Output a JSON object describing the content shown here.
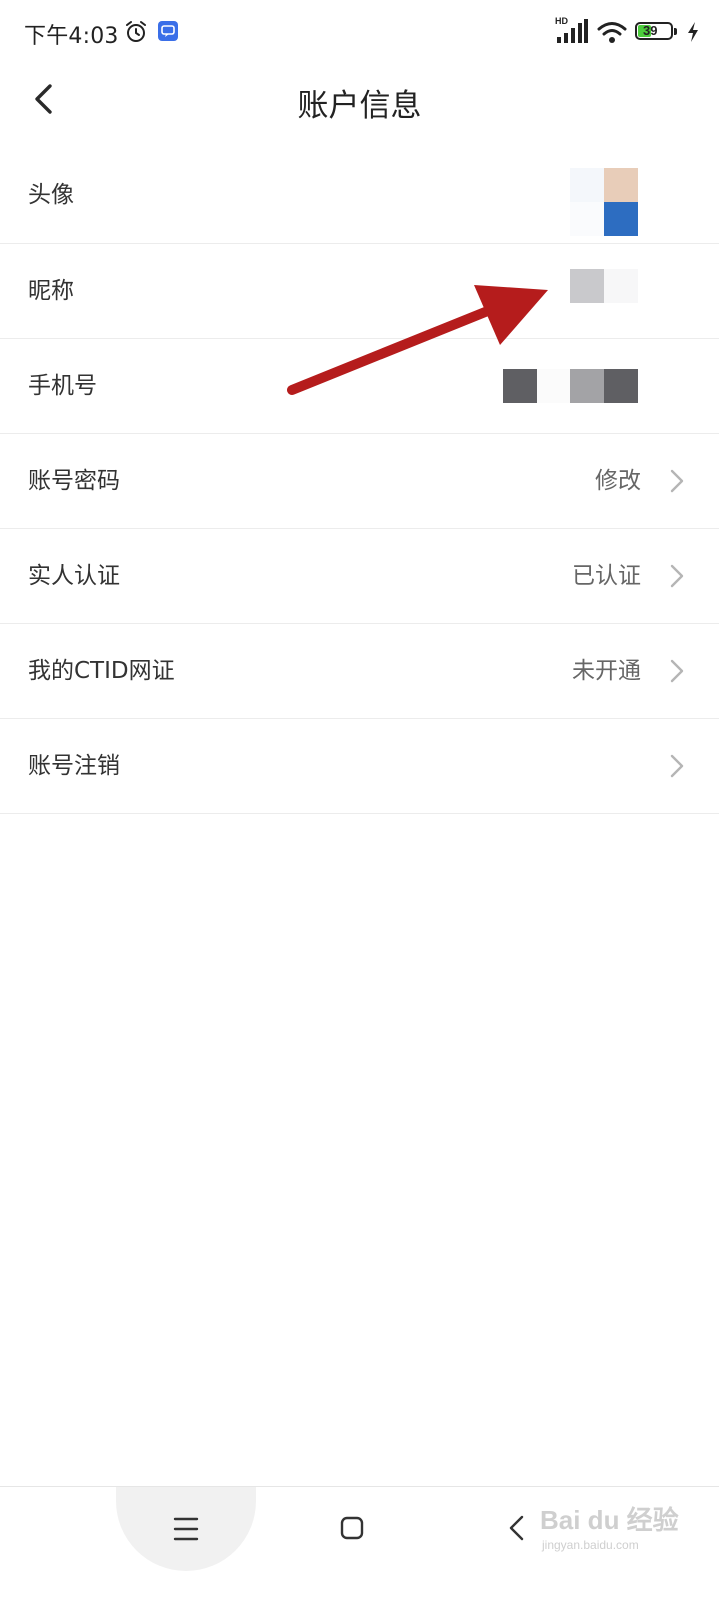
{
  "status_bar": {
    "time": "下午4:03",
    "network_label": "HD",
    "battery_level": "39",
    "charging": true,
    "alarm_icon": "alarm-clock-icon",
    "app_notification_icon": "chat-notification-icon"
  },
  "header": {
    "title": "账户信息",
    "back_icon": "back-chevron-icon"
  },
  "rows": [
    {
      "label": "头像",
      "value": "",
      "has_chevron": false
    },
    {
      "label": "昵称",
      "value": "",
      "has_chevron": false
    },
    {
      "label": "手机号",
      "value": "",
      "has_chevron": false
    },
    {
      "label": "账号密码",
      "value": "修改",
      "has_chevron": true
    },
    {
      "label": "实人认证",
      "value": "已认证",
      "has_chevron": true
    },
    {
      "label": "我的CTID网证",
      "value": "未开通",
      "has_chevron": true
    },
    {
      "label": "账号注销",
      "value": "",
      "has_chevron": true
    }
  ],
  "annotation": {
    "color": "#b51c1c",
    "icon": "red-arrow-annotation"
  },
  "navigation_bar": {
    "menu_icon": "menu-icon",
    "home_icon": "home-square-icon",
    "back_icon": "back-chevron-icon"
  },
  "watermark": {
    "main": "Bai du 经验",
    "sub": "jingyan.baidu.com"
  },
  "colors": {
    "accent_app_icon": "#3b6fe8",
    "battery_fill": "#4ccd3c",
    "divider": "#ececec"
  }
}
